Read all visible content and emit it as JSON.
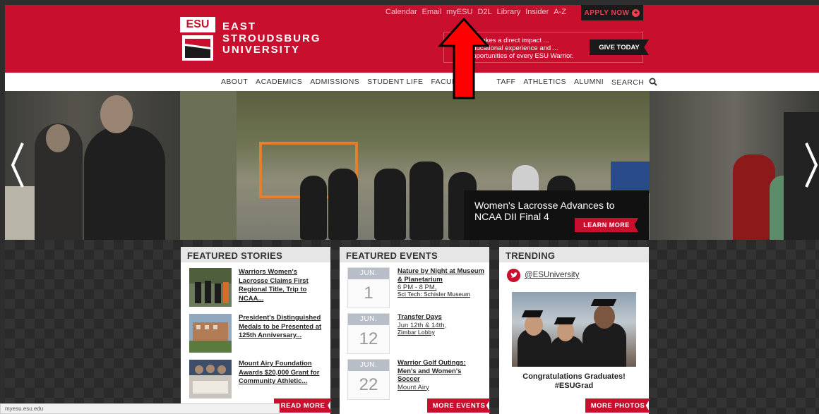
{
  "header": {
    "logo_abbr": "ESU",
    "name_lines": [
      "EAST",
      "STROUDSBURG",
      "UNIVERSITY"
    ],
    "utility_links": [
      "Calendar",
      "Email",
      "myESU",
      "D2L",
      "Library",
      "Insider",
      "A-Z"
    ],
    "apply_label": "APPLY NOW",
    "give_text": "... makes a direct impact ... educational experience and ... opportunities of every ESU Warrior.",
    "give_label": "GIVE TODAY",
    "accent_color": "#c8102e"
  },
  "main_nav": {
    "items": [
      "ABOUT",
      "ACADEMICS",
      "ADMISSIONS",
      "STUDENT LIFE",
      "FACUL",
      "TAFF",
      "ATHLETICS",
      "ALUMNI",
      "SEARCH"
    ]
  },
  "hero": {
    "caption_title": "Women's Lacrosse Advances to NCAA DII Final 4",
    "learn_more": "LEARN MORE",
    "prev_icon": "chevron-left-icon",
    "next_icon": "chevron-right-icon"
  },
  "featured_stories": {
    "heading": "FEATURED STORIES",
    "items": [
      {
        "title": "Warriors Women's Lacrosse Claims First Regional Title, Trip to NCAA..."
      },
      {
        "title": "President's Distinguished Medals to be Presented at 125th Anniversary..."
      },
      {
        "title": "Mount Airy Foundation Awards $20,000 Grant for Community Athletic..."
      }
    ],
    "button": "READ MORE"
  },
  "featured_events": {
    "heading": "FEATURED EVENTS",
    "items": [
      {
        "month": "JUN.",
        "day": "1",
        "title": "Nature by Night at Museum & Planetarium",
        "time": "6 PM - 8 PM,",
        "location": "Sci Tech: Schisler Museum"
      },
      {
        "month": "JUN.",
        "day": "12",
        "title": "Transfer Days",
        "time": "Jun 12th & 14th,",
        "location": "Zimbar Lobby"
      },
      {
        "month": "JUN.",
        "day": "22",
        "title": "Warrior Golf Outings: Men's and Women's Soccer",
        "time": "Mount Airy",
        "location": ""
      }
    ],
    "button": "MORE EVENTS"
  },
  "trending": {
    "heading": "TRENDING",
    "twitter_handle": "@ESUniversity",
    "caption": "Congratulations Graduates! #ESUGrad",
    "button": "MORE PHOTOS"
  },
  "status_bar": {
    "url": "myesu.esu.edu"
  }
}
